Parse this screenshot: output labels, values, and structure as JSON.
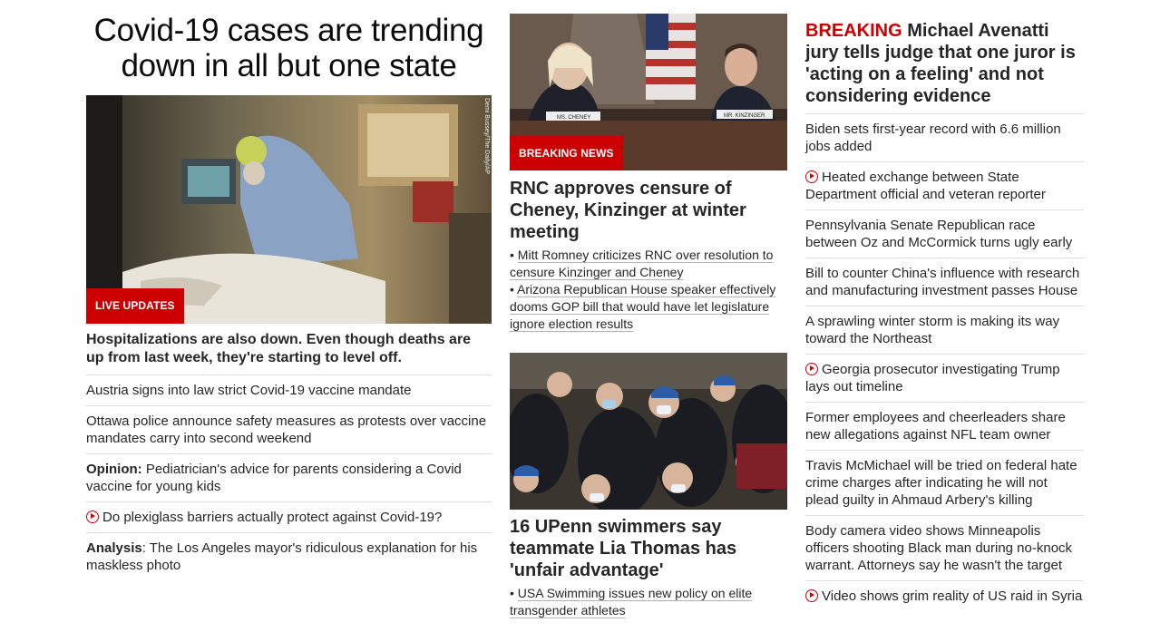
{
  "col1": {
    "headline": "Covid-19 cases are trending down in all but one state",
    "image_tag": "LIVE UPDATES",
    "photo_credit": "Demi Bussey/The Daily/AP",
    "subhead": "Hospitalizations are also down. Even though deaths are up from last week, they're starting to level off.",
    "stories": [
      {
        "prefix": "",
        "text": "Austria signs into law strict Covid-19 vaccine mandate",
        "video": false
      },
      {
        "prefix": "",
        "text": "Ottawa police announce safety measures as protests over vaccine mandates carry into second weekend",
        "video": false
      },
      {
        "prefix": "Opinion:",
        "text": "Pediatrician's advice for parents considering a Covid vaccine for young kids",
        "video": false
      },
      {
        "prefix": "",
        "text": "Do plexiglass barriers actually protect against Covid-19?",
        "video": true
      },
      {
        "prefix": "Analysis",
        "text": ": The Los Angeles mayor's ridiculous explanation for his maskless photo",
        "video": false
      }
    ]
  },
  "col2": {
    "image_tag": "BREAKING NEWS",
    "nameplate_left": "MS. CHENEY",
    "nameplate_right": "MR. KINZINGER",
    "headline1": "RNC approves censure of Cheney, Kinzinger at winter meeting",
    "bullets1": [
      "Mitt Romney criticizes RNC over resolution to censure Kinzinger and Cheney",
      "Arizona Republican House speaker effectively dooms GOP bill that would have let legislature ignore election results"
    ],
    "headline2": "16 UPenn swimmers say teammate Lia Thomas has 'unfair advantage'",
    "bullets2": [
      "USA Swimming issues new policy on elite transgender athletes"
    ]
  },
  "col3": {
    "breaking_label": "BREAKING",
    "breaking_text": " Michael Avenatti jury tells judge that one juror is 'acting on a feeling' and not considering evidence",
    "stories": [
      {
        "text": "Biden sets first-year record with 6.6 million jobs added",
        "video": false
      },
      {
        "text": "Heated exchange between State Department official and veteran reporter",
        "video": true
      },
      {
        "text": "Pennsylvania Senate Republican race between Oz and McCormick turns ugly early",
        "video": false
      },
      {
        "text": "Bill to counter China's influence with research and manufacturing investment passes House",
        "video": false
      },
      {
        "text": "A sprawling winter storm is making its way toward the Northeast",
        "video": false
      },
      {
        "text": "Georgia prosecutor investigating Trump lays out timeline",
        "video": true
      },
      {
        "text": "Former employees and cheerleaders share new allegations against NFL team owner",
        "video": false
      },
      {
        "text": "Travis McMichael will be tried on federal hate crime charges after indicating he will not plead guilty in Ahmaud Arbery's killing",
        "video": false
      },
      {
        "text": "Body camera video shows Minneapolis officers shooting Black man during no-knock warrant. Attorneys say he wasn't the target",
        "video": false
      },
      {
        "text": "Video shows grim reality of US raid in Syria",
        "video": true
      }
    ]
  },
  "colors": {
    "accent_red": "#cc0000",
    "text": "#262626",
    "divider": "#dedede"
  }
}
